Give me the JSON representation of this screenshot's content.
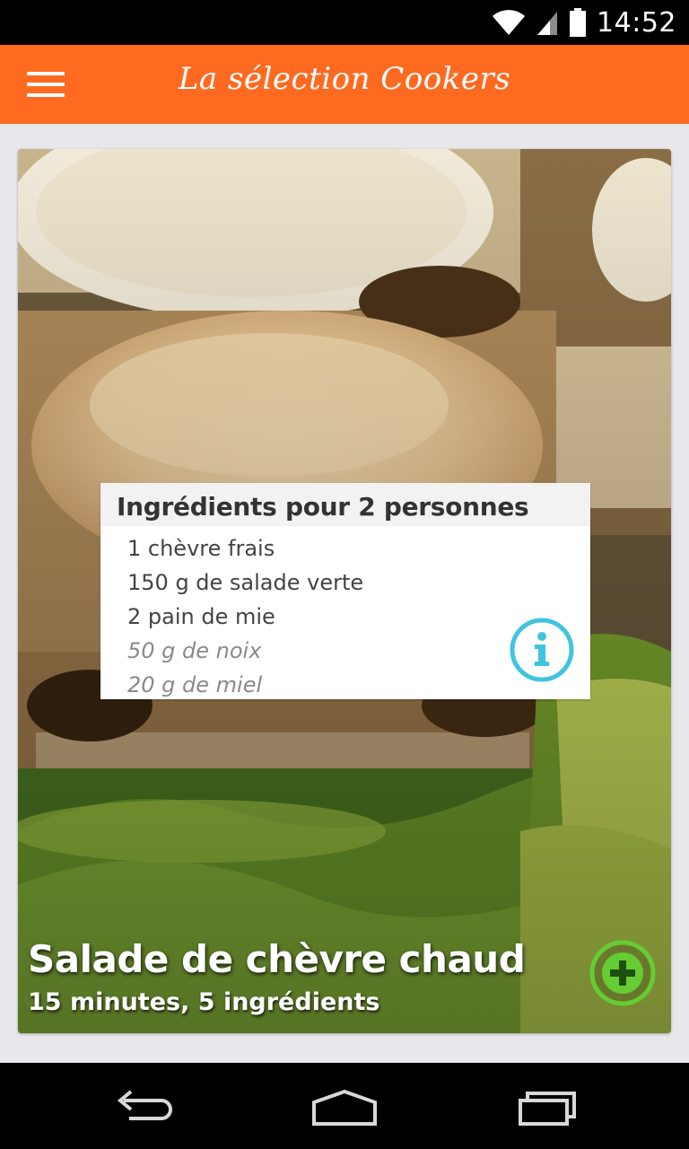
{
  "status_bar": {
    "time": "14:52",
    "icons": [
      "wifi-icon",
      "cell-signal-icon",
      "battery-icon"
    ]
  },
  "app_bar": {
    "title": "La sélection Cookers",
    "menu_icon": "hamburger-menu-icon"
  },
  "recipe": {
    "title": "Salade de chèvre chaud",
    "meta": "15 minutes, 5 ingrédients",
    "ingredients_header": "Ingrédients pour 2 personnes",
    "ingredients": [
      {
        "text": "1 chèvre frais",
        "optional": false
      },
      {
        "text": "150 g de salade verte",
        "optional": false
      },
      {
        "text": "2 pain de mie",
        "optional": false
      },
      {
        "text": "50 g de noix",
        "optional": true
      },
      {
        "text": "20 g de miel",
        "optional": true
      }
    ],
    "info_icon": "info-icon",
    "add_icon": "plus-icon"
  },
  "colors": {
    "accent": "#ff6a21",
    "info": "#3fc4e0",
    "add": "#66cc33",
    "background": "#e8e8ec"
  },
  "nav_bar": {
    "buttons": [
      "back-icon",
      "home-icon",
      "recent-apps-icon"
    ]
  }
}
